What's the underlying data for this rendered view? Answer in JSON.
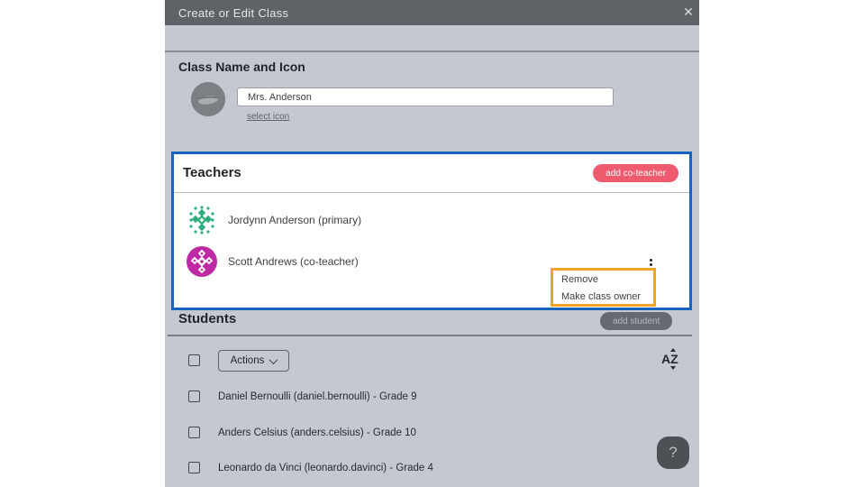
{
  "modal": {
    "title": "Create or Edit Class",
    "close_icon": "✕"
  },
  "class_section": {
    "heading": "Class Name and Icon",
    "name_value": "Mrs. Anderson",
    "select_icon_label": "select icon"
  },
  "teachers": {
    "heading": "Teachers",
    "add_button_label": "add co-teacher",
    "rows": [
      {
        "name": "Jordynn Anderson (primary)",
        "avatar_color": "#2fae7e"
      },
      {
        "name": "Scott Andrews (co-teacher)",
        "avatar_color": "#bd2aa4"
      }
    ],
    "context_menu": {
      "items": [
        {
          "label": "Remove"
        },
        {
          "label": "Make class owner"
        }
      ]
    }
  },
  "students": {
    "heading": "Students",
    "add_button_label": "add student",
    "actions_button_label": "Actions",
    "rows": [
      {
        "label": "Daniel Bernoulli (daniel.bernoulli) - Grade 9"
      },
      {
        "label": "Anders Celsius (anders.celsius) - Grade 10"
      },
      {
        "label": "Leonardo da Vinci (leonardo.davinci) - Grade 4"
      }
    ]
  },
  "help_button": {
    "label": "?"
  },
  "colors": {
    "highlight_blue": "#1565c0",
    "highlight_orange": "#f0a326",
    "add_coteacher_red": "#ee5a6e",
    "add_student_gray": "#646a70",
    "header_gray": "#5e6367",
    "body_gray": "#c5c9cf"
  }
}
